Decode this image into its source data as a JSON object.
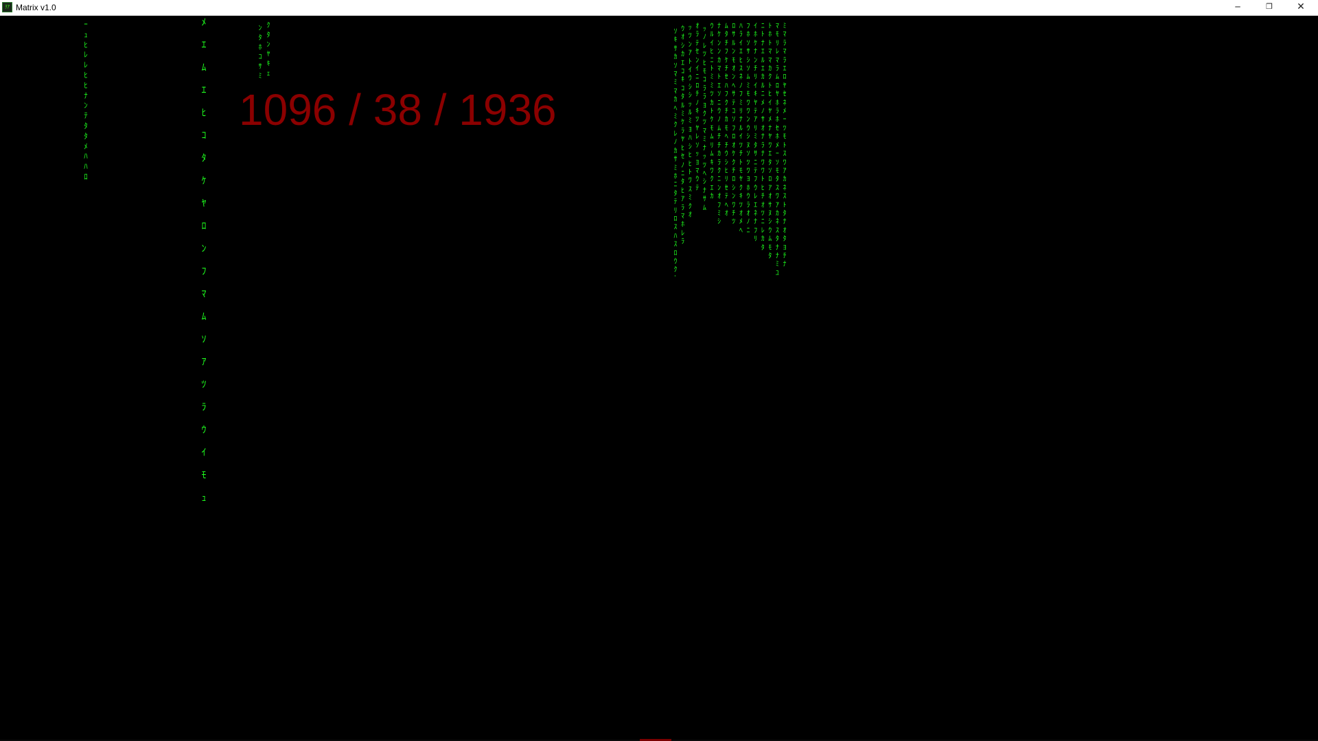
{
  "window": {
    "title": "Matrix v1.0",
    "icon": "matrix-app-icon",
    "icon_glyph": "ｦｱ",
    "controls": {
      "minimize": "─",
      "maximize": "❐",
      "close": "✕"
    }
  },
  "stats": {
    "text": "1096 / 38 / 1936"
  },
  "colors": {
    "rain": "#1eff1e",
    "stats": "#8b0000",
    "background": "#000000"
  },
  "rain": {
    "column_a": "ｰ\nｭ\nﾋ\nﾚ\nﾚ\nﾋ\nﾋ\nﾅ\nﾝ\nﾃ\nﾀ\nﾀ\nﾒ\nﾊ\nﾊ\nﾛ",
    "column_b": "ﾒ\nｴ\nﾑ\nｴ\nﾋ\nｺ\nﾀ\nｹ\nﾔ\nﾛ\nﾝ\nﾌ\nﾏ\nﾑ\nｿ\nｱ\nﾂ\nﾗ\nｳ\nｲ\nﾓ\nｭ",
    "column_c1": "ﾝ\nﾀ\nﾎ\nｺ\nｻ\nﾐ",
    "column_c2": "ｸ\nﾀ\nﾝ\nﾔ\nｷ\nｪ",
    "dense_columns": [
      "ｿ\nｷ\nｻ\nｶ\nｿ\nﾏ\nﾐ\nﾏ\nｶ\nﾍ\nﾐ\nｸ\nﾚ\nﾉ\nｶ\nｻ\nﾐ\nﾎ\nﾆ\nﾀ\nﾃ\nﾘ\nﾛ\nｽ\nﾊ\nｽ\nﾛ\nｳ\nｸ\nﾄ",
      "ｳ\nｵ\nｼ\nｶ\nｴ\nｺ\nｷ\nｺ\nﾀ\nﾙ\nﾐ\nｹ\nﾗ\nﾔ\nﾋ\nｾ\nﾉ\nﾆ\nﾀ\nﾋ\nｱ\nﾗ\nﾏ\nﾎ\nﾚ\nﾗ",
      "ｯ\nﾂ\nﾝ\nｱ\nﾄ\nｲ\nｳ\nｼ\nｼ\nｯ\nﾙ\nﾐ\nﾖ\nﾊ\nｼ\nﾋ\nﾋ\nﾄ\nﾜ\nｽ\nﾐ\nｸ\nｵ",
      "ｵ\nﾗ\nﾃ\nｾ\nﾝ\nｲ\nﾆ\nﾛ\nﾁ\nﾉ\nｷ\nﾂ\nﾔ\nﾚ\nｿ\nｯ\nﾖ\nﾏ\nｳ\nﾃ",
      "ｯ\nﾉ\nﾚ\nﾂ\nﾋ\nﾓ\nｺ\nﾗ\nﾗ\nﾖ\nｸ\nﾂ\nﾏ\nﾐ\nﾅ\nｯ\nﾂ\nﾍ\nｼ\nﾅ\nｻ\nﾑ",
      "ｳ\nﾙ\nｲ\nﾋ\nﾆ\nﾄ\nﾐ\nﾐ\nﾂ\nｶ\nﾄ\nｹ\nﾓ\nﾑ\nﾘ\nﾑ\nｷ\nﾜ\nｸ\nｴ\nｶ",
      "ﾅ\nｹ\nﾝ\nﾝ\nｶ\nﾏ\nﾄ\nｴ\nｿ\nﾆ\nｳ\nﾉ\nﾑ\nﾁ\nﾁ\nｶ\nﾗ\nｸ\nﾆ\nﾝ\nｵ\nﾌ\nﾐ\nｼ",
      "ﾑ\nﾀ\nﾁ\nﾌ\nｹ\nﾁ\nｾ\nﾊ\nﾌ\nｸ\nﾁ\nｶ\nﾓ\nﾍ\nﾁ\nｳ\nｼ\nﾋ\nﾘ\nｾ\nﾃ\nﾍ\nｵ",
      "ﾛ\nｻ\nﾙ\nﾝ\nﾓ\nｵ\nﾝ\nﾍ\nｻ\nﾃ\nｺ\nｿ\nﾌ\nﾛ\nｵ\nｹ\nｸ\nﾁ\nﾛ\nｼ\nﾝ\nﾜ\nﾁ\nﾂ",
      "ﾊ\nﾗ\nｲ\nｴ\nﾋ\nｽ\nﾈ\nﾉ\nﾌ\nﾐ\nﾘ\nﾅ\nﾙ\nｲ\nﾂ\nﾁ\nﾄ\nﾓ\nﾔ\nｸ\nｷ\nﾂ\nｵ\nﾒ\nﾍ",
      "ﾌ\nﾎ\nｿ\nｻ\nｼ\nｿ\nﾑ\nﾐ\nﾓ\nﾜ\nﾜ\nﾝ\nｳ\nｼ\nﾇ\nｿ\nﾂ\nﾜ\nﾖ\nﾎ\nｳ\nﾗ\nｵ\nﾉ\nﾆ",
      "ｲ\nﾎ\nｹ\nﾅ\nﾝ\nﾁ\nﾘ\nｲ\nｷ\nﾔ\nﾃ\nｱ\nﾘ\nﾐ\nﾀ\nｻ\nﾆ\nﾃ\nﾌ\nｳ\nﾚ\nｴ\nﾈ\nﾅ\nﾌ\nﾘ",
      "ﾆ\nﾄ\nﾅ\nｴ\nﾙ\nｴ\nｶ\nﾙ\nﾆ\nﾒ\nﾉ\nｻ\nｵ\nﾅ\nﾗ\nﾅ\nﾜ\nﾜ\nﾄ\nﾋ\nﾁ\nｵ\nﾂ\nﾆ\nﾚ\nｶ\nﾀ",
      "ﾄ\nﾎ\nﾄ\nﾏ\nﾏ\nｶ\nｸ\nﾄ\nﾋ\nｲ\nﾔ\nﾒ\nﾅ\nﾔ\nﾜ\nｴ\nﾀ\nｿ\nﾛ\nｱ\nｵ\nｻ\nﾇ\nｼ\nｳ\nﾑ\nﾓ\nﾀ",
      "ﾏ\nﾓ\nﾘ\nﾚ\nﾏ\nﾗ\nﾑ\nﾛ\nﾔ\nﾎ\nﾗ\nﾎ\nｾ\nﾎ\nﾒ\nｰ\nｿ\nﾓ\nﾀ\nｽ\nﾜ\nｱ\nｶ\nﾈ\nｽ\nﾀ\nﾅ\nﾅ\nﾐ\nﾕ\nﾂ\nｶ",
      "ﾐ\nﾏ\nﾗ\nﾏ\nﾗ\nｴ\nﾛ\nﾔ\nｾ\nﾈ\nﾒ\nｰ\nﾂ\nﾓ\nﾄ\nｽ\nﾜ\nｱ\nｶ\nﾈ\nｽ\nﾄ\nﾀ\nﾅ\nｵ\nﾀ\nﾖ\nﾁ\nﾅ"
    ]
  }
}
